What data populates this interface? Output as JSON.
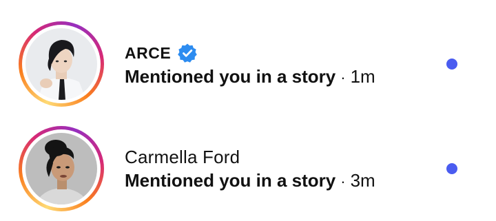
{
  "colors": {
    "unread_dot": "#4a5cf0",
    "verified_badge": "#2d8cf0",
    "story_ring": [
      "#feda75",
      "#fa7e1e",
      "#d62976",
      "#962fbf"
    ]
  },
  "notifications": [
    {
      "username": "ARCE",
      "verified": true,
      "verified_icon": "verified-badge-icon",
      "message": "Mentioned you in a story",
      "separator": "·",
      "time": "1m",
      "unread": true
    },
    {
      "username": "Carmella Ford",
      "verified": false,
      "message": "Mentioned you in a story",
      "separator": "·",
      "time": "3m",
      "unread": true
    }
  ]
}
